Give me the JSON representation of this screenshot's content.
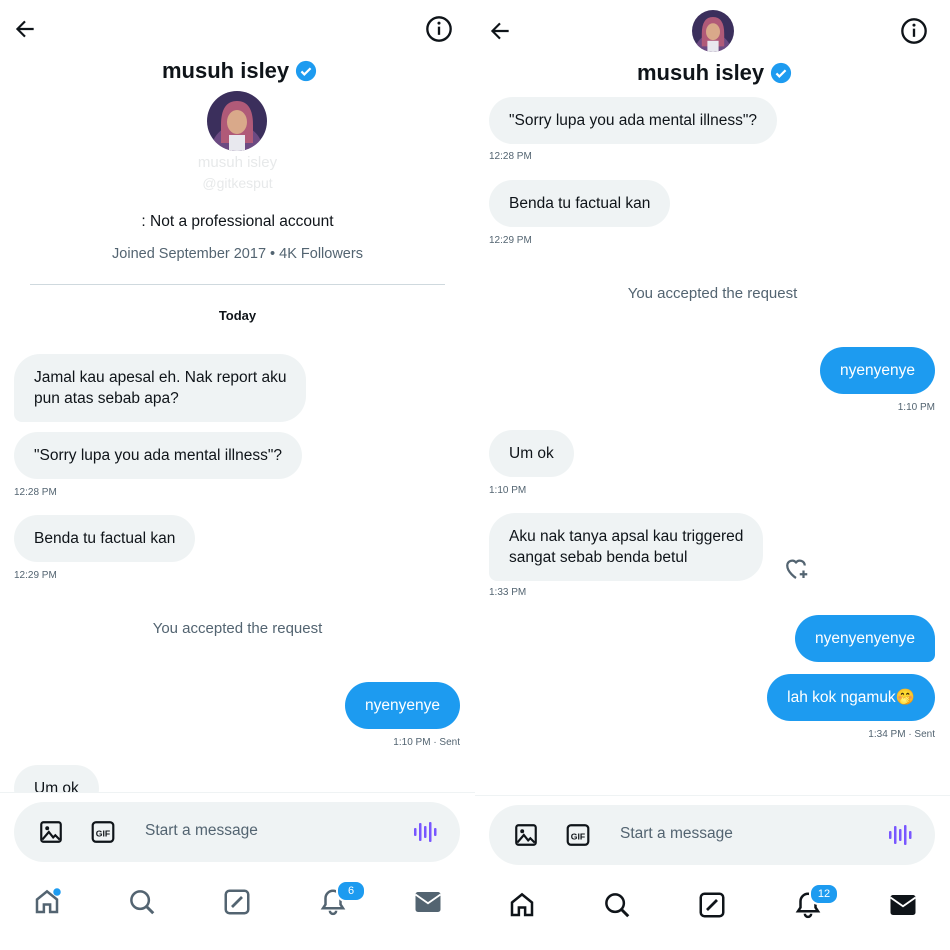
{
  "colors": {
    "accent": "#1d9bf0",
    "bubble_in": "#eff3f4",
    "muted": "#536471"
  },
  "left": {
    "header": {
      "name": "musuh isley",
      "back_icon": "arrow-left-icon",
      "info_icon": "info-icon"
    },
    "profile": {
      "faded_name": "musuh isley",
      "faded_handle": "@gitkesput",
      "account_type": ": Not a professional account",
      "meta": "Joined September 2017 • 4K Followers"
    },
    "date_label": "Today",
    "messages": [
      {
        "text": "Jamal kau apesal eh. Nak report aku",
        "text2": "pun atas sebab apa?"
      },
      {
        "text": "\"Sorry lupa you ada mental illness\"?",
        "time": "12:28 PM"
      },
      {
        "text": "Benda tu factual kan",
        "time": "12:29 PM"
      },
      {
        "text": "nyenyenye",
        "time": "1:10 PM · Sent"
      },
      {
        "text": "Um ok"
      }
    ],
    "system": "You accepted the request",
    "composer": {
      "placeholder": "Start a message"
    },
    "nav": {
      "notif_count": "6"
    }
  },
  "right": {
    "header": {
      "name": "musuh isley"
    },
    "messages": [
      {
        "text": "\"Sorry lupa you ada mental illness\"?",
        "time": "12:28 PM"
      },
      {
        "text": "Benda tu factual kan",
        "time": "12:29 PM"
      },
      {
        "text": "nyenyenye",
        "time": "1:10 PM"
      },
      {
        "text": "Um ok",
        "time": "1:10 PM"
      },
      {
        "text": "Aku nak tanya apsal kau triggered",
        "text2": "sangat sebab benda betul",
        "time": "1:33 PM"
      },
      {
        "text": "nyenyenyenye"
      },
      {
        "text": "lah kok ngamuk🤭",
        "time": "1:34 PM · Sent"
      }
    ],
    "system": "You accepted the request",
    "composer": {
      "placeholder": "Start a message"
    },
    "nav": {
      "notif_count": "12"
    }
  }
}
